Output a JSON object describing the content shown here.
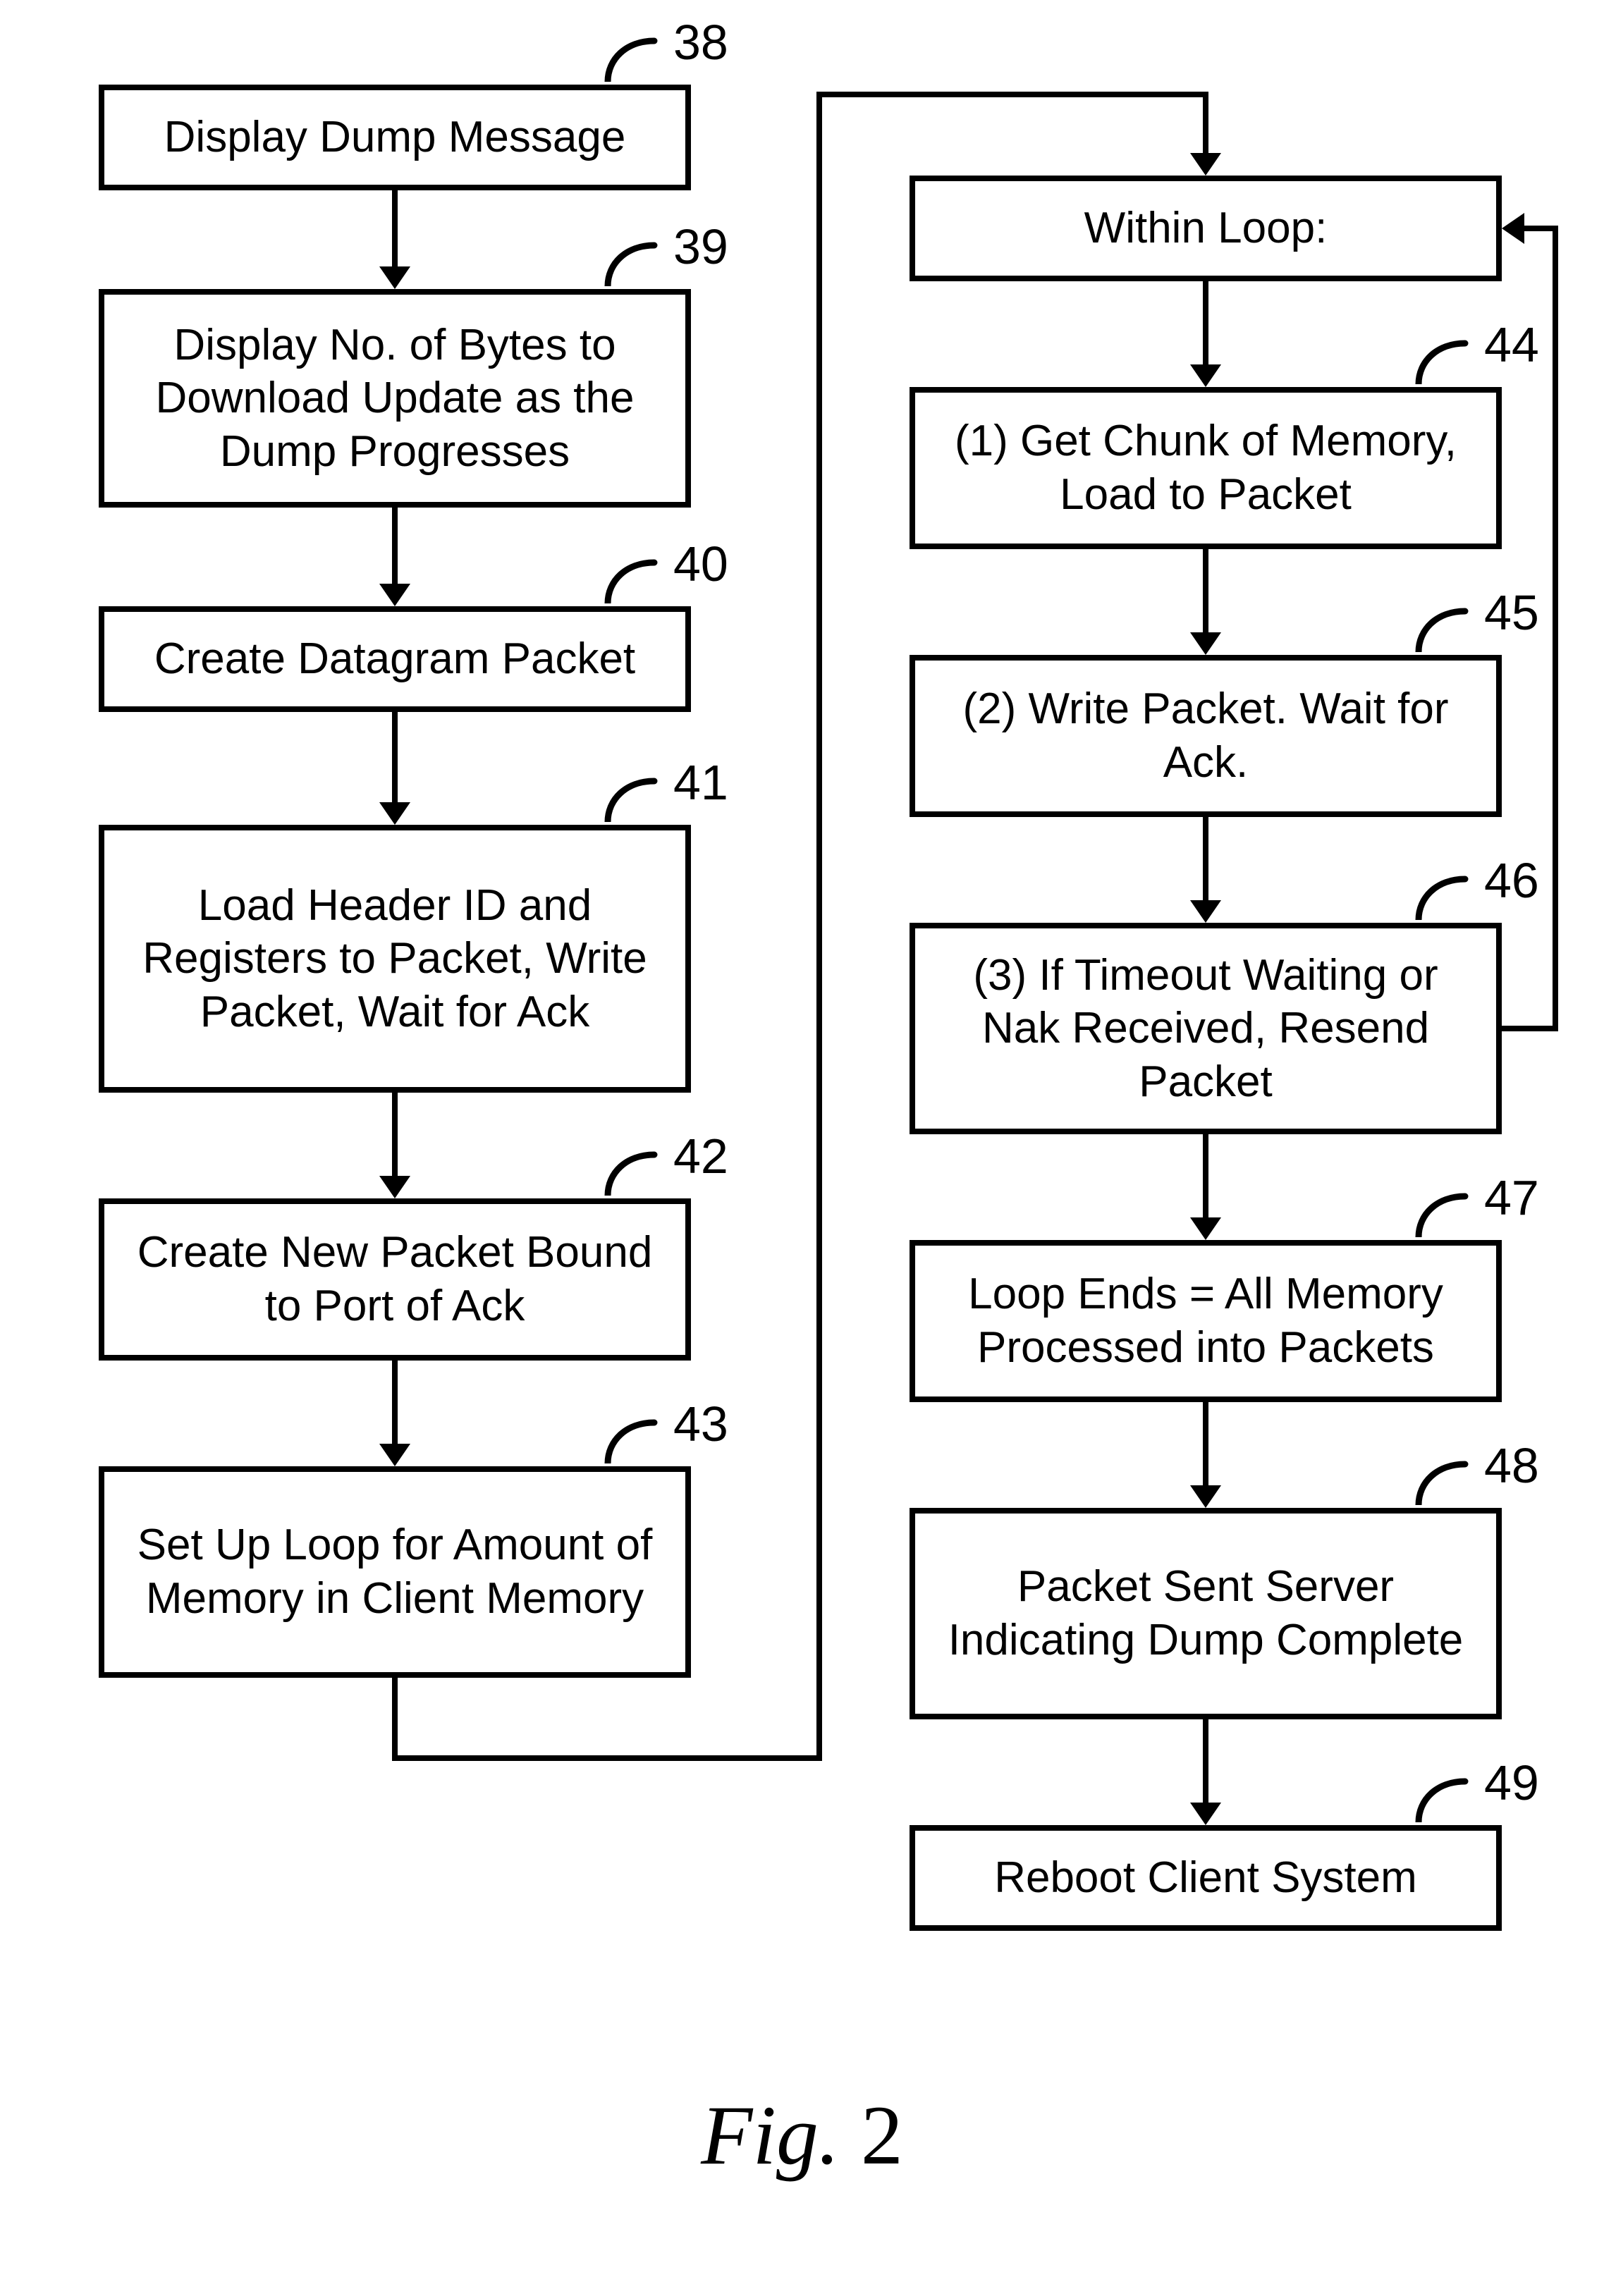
{
  "chart_data": {
    "type": "flowchart",
    "caption": "Fig. 2",
    "nodes": [
      {
        "id": "38",
        "text": "Display Dump Message"
      },
      {
        "id": "39",
        "text": "Display No. of Bytes to Download Update as the Dump Progresses"
      },
      {
        "id": "40",
        "text": "Create Datagram Packet"
      },
      {
        "id": "41",
        "text": "Load Header ID and Registers to Packet, Write Packet, Wait for Ack"
      },
      {
        "id": "42",
        "text": "Create New Packet Bound to Port of Ack"
      },
      {
        "id": "43",
        "text": "Set Up Loop for Amount of Memory in Client Memory"
      },
      {
        "id": "loop",
        "text": "Within Loop:"
      },
      {
        "id": "44",
        "text": "(1) Get Chunk of Memory, Load to Packet"
      },
      {
        "id": "45",
        "text": "(2) Write Packet. Wait for Ack."
      },
      {
        "id": "46",
        "text": "(3) If Timeout Waiting or Nak Received, Resend Packet"
      },
      {
        "id": "47",
        "text": "Loop Ends = All Memory Processed into Packets"
      },
      {
        "id": "48",
        "text": "Packet Sent Server Indicating Dump Complete"
      },
      {
        "id": "49",
        "text": "Reboot Client System"
      }
    ],
    "edges": [
      [
        "38",
        "39"
      ],
      [
        "39",
        "40"
      ],
      [
        "40",
        "41"
      ],
      [
        "41",
        "42"
      ],
      [
        "42",
        "43"
      ],
      [
        "43",
        "loop"
      ],
      [
        "loop",
        "44"
      ],
      [
        "44",
        "45"
      ],
      [
        "45",
        "46"
      ],
      [
        "46",
        "47"
      ],
      [
        "47",
        "48"
      ],
      [
        "48",
        "49"
      ],
      [
        "46",
        "loop"
      ]
    ]
  },
  "labels": {
    "n38": "38",
    "n39": "39",
    "n40": "40",
    "n41": "41",
    "n42": "42",
    "n43": "43",
    "n44": "44",
    "n45": "45",
    "n46": "46",
    "n47": "47",
    "n48": "48",
    "n49": "49"
  },
  "caption_prefix": "Fig.  ",
  "caption_number": "2"
}
